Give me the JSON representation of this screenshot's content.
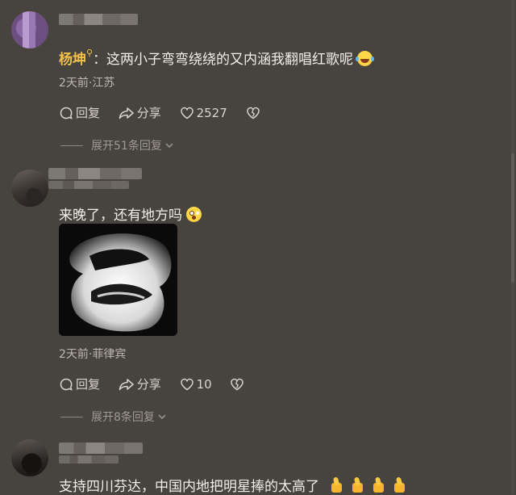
{
  "comments": [
    {
      "author": "杨坤",
      "text": "：这两小子弯弯绕绕的又内涵我翻唱红歌呢",
      "emoji": "rolling-laughing-emoji",
      "meta": "2天前·江苏",
      "reply_label": "回复",
      "share_label": "分享",
      "likes": "2527",
      "expand_label": "展开51条回复"
    },
    {
      "text": "来晚了，还有地方吗",
      "emoji": "astonished-emoji",
      "meta": "2天前·菲律宾",
      "reply_label": "回复",
      "share_label": "分享",
      "likes": "10",
      "expand_label": "展开8条回复"
    },
    {
      "text": "支持四川芬达，中国内地把明星捧的太高了",
      "emoji": "thumbs-up-emoji"
    }
  ],
  "colors": {
    "background": "#47433f",
    "author_gold": "#f2c14a",
    "meta_text": "#bdb7b1"
  }
}
